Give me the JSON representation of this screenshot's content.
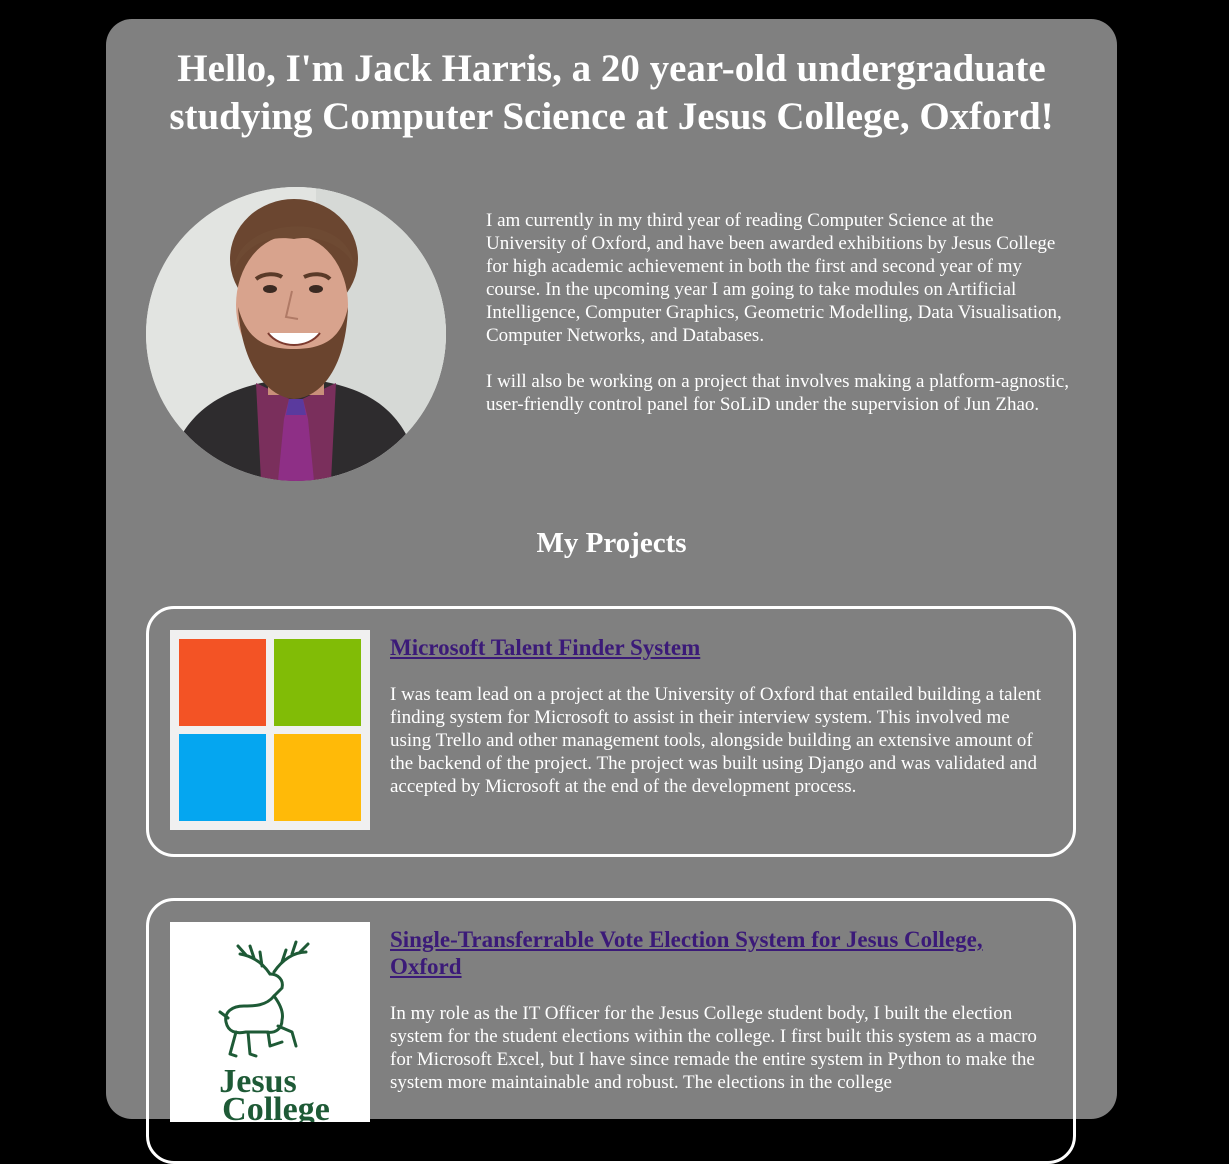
{
  "header": {
    "title": "Hello, I'm Jack Harris, a 20 year-old undergraduate studying Computer Science at Jesus College, Oxford!"
  },
  "profile": {
    "photo_icon": "profile-photo",
    "intro_paragraphs": [
      "I am currently in my third year of reading Computer Science at the University of Oxford, and have been awarded exhibitions by Jesus College for high academic achievement in both the first and second year of my course. In the upcoming year I am going to take modules on Artificial Intelligence, Computer Graphics, Geometric Modelling, Data Visualisation, Computer Networks, and Databases.",
      "I will also be working on a project that involves making a platform-agnostic, user-friendly control panel for SoLiD under the supervision of Jun Zhao."
    ]
  },
  "projects": {
    "heading": "My Projects",
    "items": [
      {
        "title": "Microsoft Talent Finder System",
        "logo_icon": "microsoft-logo",
        "description": "I was team lead on a project at the University of Oxford that entailed building a talent finding system for Microsoft to assist in their interview system. This involved me using Trello and other management tools, alongside building an extensive amount of the backend of the project. The project was built using Django and was validated and accepted by Microsoft at the end of the development process."
      },
      {
        "title": "Single-Transferrable Vote Election System for Jesus College, Oxford",
        "logo_icon": "jesus-college-logo",
        "logo_text_line1": "Jesus",
        "logo_text_line2": "College",
        "description": "In my role as the IT Officer for the Jesus College student body, I built the election system for the student elections within the college. I first built this system as a macro for Microsoft Excel, but I have since remade the entire system in Python to make the system more maintainable and robust. The elections in the college"
      }
    ]
  },
  "colors": {
    "page_background": "#000000",
    "panel_background": "#808080",
    "text": "#ffffff",
    "link": "#3b1a78",
    "ms_red": "#f35325",
    "ms_green": "#81bc06",
    "ms_blue": "#05a6f0",
    "ms_yellow": "#ffba08",
    "jesus_green": "#1e5a36"
  }
}
